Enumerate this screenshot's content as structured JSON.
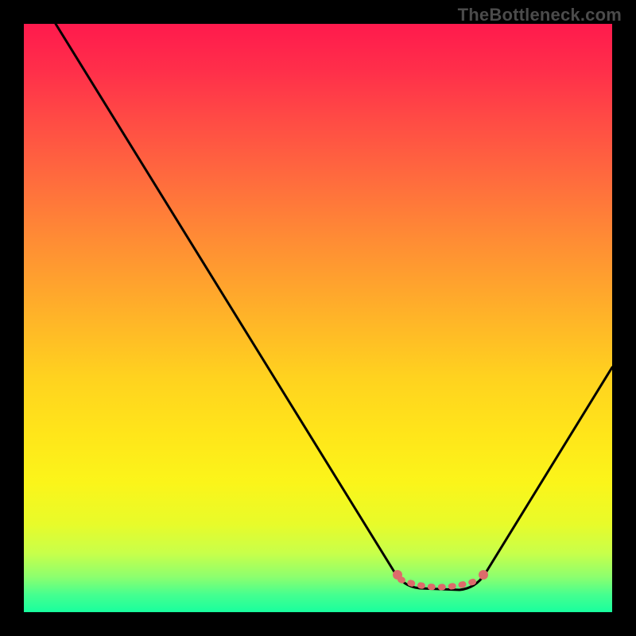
{
  "watermark": "TheBottleneck.com",
  "chart_data": {
    "type": "line",
    "title": "",
    "xlabel": "",
    "ylabel": "",
    "xlim": [
      0,
      100
    ],
    "ylim": [
      0,
      100
    ],
    "grid": false,
    "legend": false,
    "series": [
      {
        "name": "bottleneck-curve",
        "x": [
          5,
          10,
          20,
          30,
          40,
          50,
          58,
          62,
          65,
          70,
          74,
          78,
          82,
          90,
          100
        ],
        "y": [
          100,
          92,
          76,
          60,
          45,
          30,
          18,
          10,
          5,
          3,
          3,
          5,
          12,
          28,
          42
        ]
      }
    ],
    "annotations": [
      {
        "name": "flat-region",
        "x_start": 64,
        "x_end": 78,
        "style": "dotted",
        "color": "#dd6b6b"
      }
    ],
    "background_gradient": {
      "direction": "vertical",
      "stops": [
        {
          "pct": 0,
          "color": "#ff1a4d"
        },
        {
          "pct": 50,
          "color": "#ffae2a"
        },
        {
          "pct": 80,
          "color": "#fbf51a"
        },
        {
          "pct": 100,
          "color": "#18ff9e"
        }
      ]
    }
  }
}
